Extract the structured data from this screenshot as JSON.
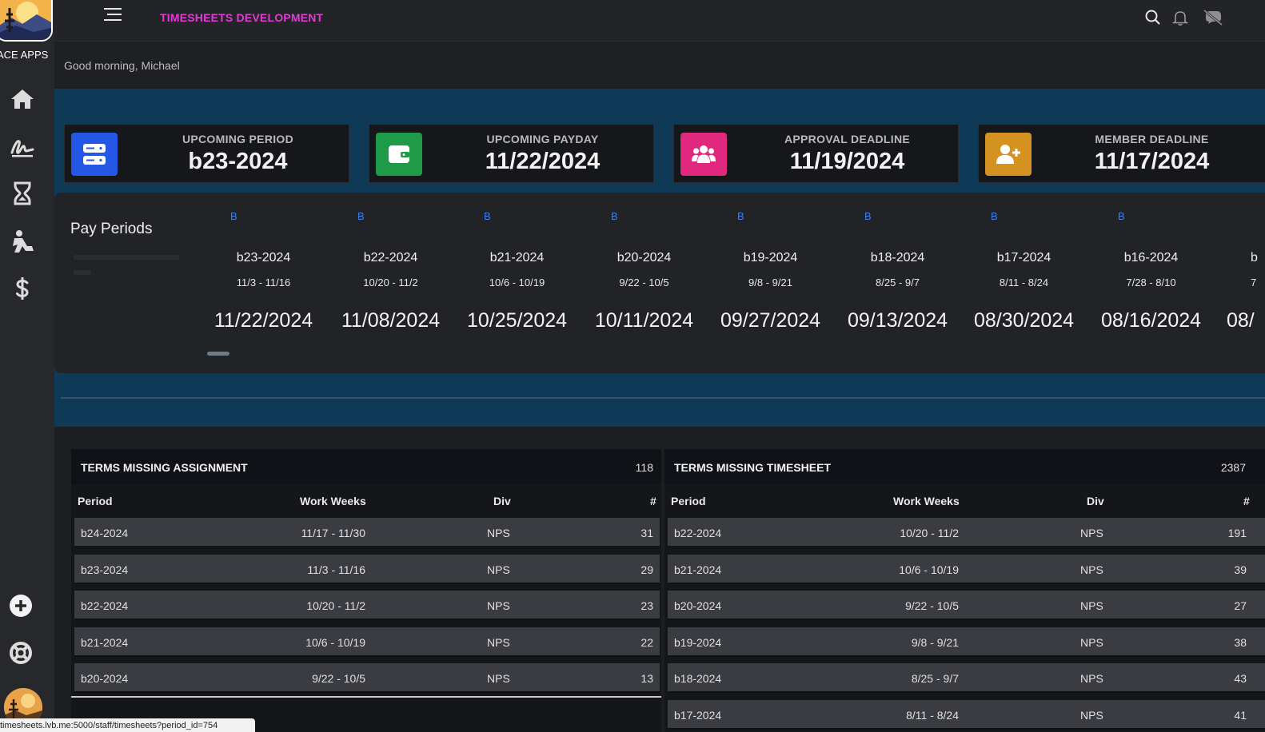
{
  "app": {
    "title": "TIMESHEETS DEVELOPMENT",
    "brand": "ACE APPS",
    "greeting": "Good morning, Michael"
  },
  "sidebar": {
    "items": [
      {
        "name": "home-icon"
      },
      {
        "name": "signature-icon"
      },
      {
        "name": "hourglass-icon"
      },
      {
        "name": "worker-icon"
      },
      {
        "name": "dollar-icon"
      }
    ]
  },
  "stats": [
    {
      "label": "UPCOMING PERIOD",
      "value": "b23-2024",
      "icon": "server-icon",
      "color": "#2457e6"
    },
    {
      "label": "UPCOMING PAYDAY",
      "value": "11/22/2024",
      "icon": "wallet-icon",
      "color": "#1f9a48"
    },
    {
      "label": "APPROVAL DEADLINE",
      "value": "11/19/2024",
      "icon": "users-icon",
      "color": "#e0287e"
    },
    {
      "label": "MEMBER DEADLINE",
      "value": "11/17/2024",
      "icon": "user-plus-icon",
      "color": "#d49221"
    }
  ],
  "pay_periods": {
    "title": "Pay Periods",
    "items": [
      {
        "badge": "B",
        "name": "b23-2024",
        "range": "11/3 - 11/16",
        "payday": "11/22/2024"
      },
      {
        "badge": "B",
        "name": "b22-2024",
        "range": "10/20 - 11/2",
        "payday": "11/08/2024"
      },
      {
        "badge": "B",
        "name": "b21-2024",
        "range": "10/6 - 10/19",
        "payday": "10/25/2024"
      },
      {
        "badge": "B",
        "name": "b20-2024",
        "range": "9/22 - 10/5",
        "payday": "10/11/2024"
      },
      {
        "badge": "B",
        "name": "b19-2024",
        "range": "9/8 - 9/21",
        "payday": "09/27/2024"
      },
      {
        "badge": "B",
        "name": "b18-2024",
        "range": "8/25 - 9/7",
        "payday": "09/13/2024"
      },
      {
        "badge": "B",
        "name": "b17-2024",
        "range": "8/11 - 8/24",
        "payday": "08/30/2024"
      },
      {
        "badge": "B",
        "name": "b16-2024",
        "range": "7/28 - 8/10",
        "payday": "08/16/2024"
      },
      {
        "badge": "",
        "name": "b",
        "range": "7",
        "payday": "08/"
      }
    ]
  },
  "terms_missing_assignment": {
    "title": "TERMS MISSING ASSIGNMENT",
    "count": "118",
    "columns": [
      "Period",
      "Work Weeks",
      "Div",
      "#"
    ],
    "rows": [
      {
        "period": "b24-2024",
        "weeks": "11/17 - 11/30",
        "div": "NPS",
        "count": "31"
      },
      {
        "period": "b23-2024",
        "weeks": "11/3 - 11/16",
        "div": "NPS",
        "count": "29"
      },
      {
        "period": "b22-2024",
        "weeks": "10/20 - 11/2",
        "div": "NPS",
        "count": "23"
      },
      {
        "period": "b21-2024",
        "weeks": "10/6 - 10/19",
        "div": "NPS",
        "count": "22"
      },
      {
        "period": "b20-2024",
        "weeks": "9/22 - 10/5",
        "div": "NPS",
        "count": "13"
      }
    ]
  },
  "terms_missing_timesheet": {
    "title": "TERMS MISSING TIMESHEET",
    "count": "2387",
    "columns": [
      "Period",
      "Work Weeks",
      "Div",
      "#"
    ],
    "rows": [
      {
        "period": "b22-2024",
        "weeks": "10/20 - 11/2",
        "div": "NPS",
        "count": "191"
      },
      {
        "period": "b21-2024",
        "weeks": "10/6 - 10/19",
        "div": "NPS",
        "count": "39"
      },
      {
        "period": "b20-2024",
        "weeks": "9/22 - 10/5",
        "div": "NPS",
        "count": "27"
      },
      {
        "period": "b19-2024",
        "weeks": "9/8 - 9/21",
        "div": "NPS",
        "count": "38"
      },
      {
        "period": "b18-2024",
        "weeks": "8/25 - 9/7",
        "div": "NPS",
        "count": "43"
      },
      {
        "period": "b17-2024",
        "weeks": "8/11 - 8/24",
        "div": "NPS",
        "count": "41"
      }
    ]
  },
  "status_url": "timesheets.lvb.me:5000/staff/timesheets?period_id=754"
}
